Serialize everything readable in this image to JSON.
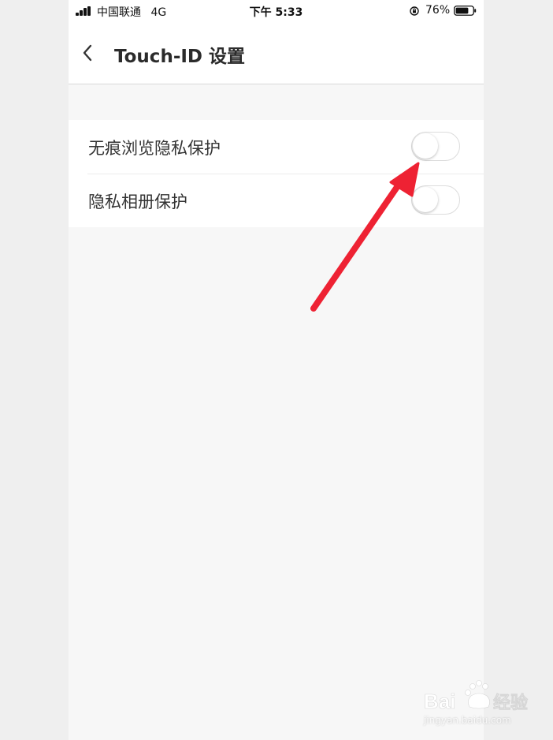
{
  "status_bar": {
    "carrier": "中国联通",
    "network": "4G",
    "time": "下午 5:33",
    "battery": "76%",
    "battery_level": 0.76
  },
  "nav": {
    "back_icon": "chevron-left-icon",
    "title": "Touch-ID 设置"
  },
  "settings": [
    {
      "label": "无痕浏览隐私保护",
      "enabled": false
    },
    {
      "label": "隐私相册保护",
      "enabled": false
    }
  ],
  "annotation": {
    "arrow_color": "#ee2233"
  },
  "watermark": {
    "brand": "Baidu经验",
    "url": "jingyan.baidu.com"
  }
}
